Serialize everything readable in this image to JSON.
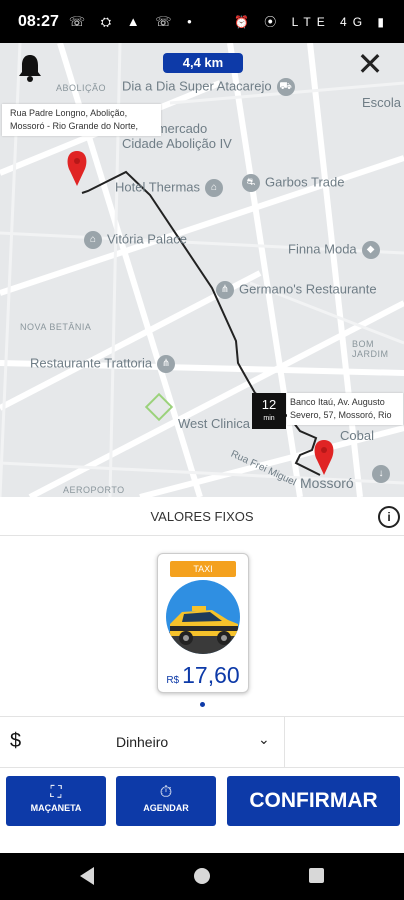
{
  "status_bar": {
    "time": "08:27",
    "left_icons": "☏ ⛭ ▲ ☏ •",
    "right_icons": "⏰ ⦿ LTE 4G ▮"
  },
  "map": {
    "distance": "4,4 km",
    "origin_address": "Rua Padre Longno, Abolição, Mossoró - Rio Grande do Norte,",
    "destination_address": "Banco Itaú, Av. Augusto Severo, 57, Mossoró, Rio",
    "eta_value": "12",
    "eta_unit": "min",
    "district_labels": [
      "ABOLIÇÃO",
      "NOVA BETÂNIA",
      "AEROPORTO",
      "BOM JARDIM"
    ],
    "places": [
      "Dia a Dia Super Atacarejo",
      "Escola Raimun",
      "Supermercado Cidade Abolição IV",
      "Hotel Thermas",
      "Garbos Trade",
      "Vitória Palace",
      "Finna Moda",
      "Germano's Restaurante",
      "Restaurante Trattoria",
      "West Clinica",
      "Cobal",
      "Mossoró",
      "Rua Frei Miguel"
    ],
    "route_color": "#222222",
    "pin_color": "#e02424"
  },
  "fare": {
    "section_title": "VALORES FIXOS",
    "card_tag": "TAXI",
    "currency": "R$",
    "price": "17,60"
  },
  "payment": {
    "currency_symbol": "$",
    "method": "Dinheiro"
  },
  "actions": {
    "macaneta_label": "MAÇANETA",
    "agendar_label": "AGENDAR",
    "confirm_label": "CONFIRMAR"
  },
  "colors": {
    "accent": "#0d3aa8",
    "tag": "#f4a11e"
  }
}
